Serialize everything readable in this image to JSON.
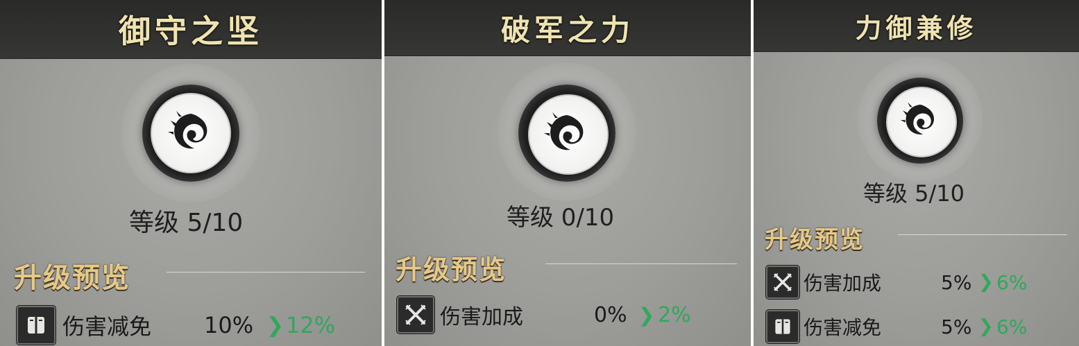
{
  "panels": [
    {
      "title": "御守之坚",
      "level": "等级 5/10",
      "preview_title": "升级预览",
      "stats": [
        {
          "icon": "shield-book-icon",
          "name": "伤害减免",
          "from": "10%",
          "to": "12%"
        }
      ]
    },
    {
      "title": "破军之力",
      "level": "等级 0/10",
      "preview_title": "升级预览",
      "stats": [
        {
          "icon": "crossed-swords-icon",
          "name": "伤害加成",
          "from": "0%",
          "to": "2%"
        }
      ]
    },
    {
      "title": "力御兼修",
      "level": "等级 5/10",
      "preview_title": "升级预览",
      "stats": [
        {
          "icon": "crossed-swords-icon",
          "name": "伤害加成",
          "from": "5%",
          "to": "6%"
        },
        {
          "icon": "shield-book-icon",
          "name": "伤害减免",
          "from": "5%",
          "to": "6%"
        }
      ]
    }
  ],
  "colors": {
    "title_text": "#efe3b0",
    "preview_title_text": "#e6c987",
    "increase_green": "#2fa85c"
  }
}
